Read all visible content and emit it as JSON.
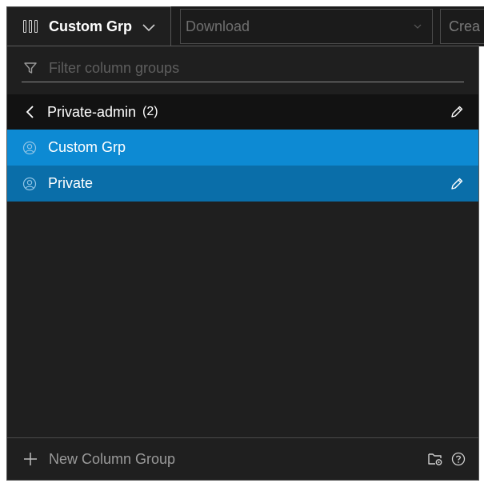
{
  "toolbar": {
    "column_group_button": {
      "label": "Custom Grp",
      "icon": "columns-icon",
      "chevron_icon": "chevron-down-icon"
    },
    "download": {
      "label": "Download",
      "chevron_icon": "chevron-down-icon"
    },
    "create": {
      "label": "Crea"
    }
  },
  "dropdown": {
    "filter": {
      "placeholder": "Filter column groups",
      "value": "",
      "icon": "filter-icon"
    },
    "group_header": {
      "label": "Private-admin",
      "count": "(2)",
      "back_icon": "chevron-left-icon",
      "edit_icon": "pencil-icon"
    },
    "items": [
      {
        "label": "Custom Grp",
        "icon": "user-icon",
        "state": "selected"
      },
      {
        "label": "Private",
        "icon": "user-icon",
        "state": "hover",
        "edit_icon": "pencil-icon"
      }
    ],
    "footer": {
      "new_label": "New Column Group",
      "plus_icon": "plus-icon",
      "folder_icon": "folder-settings-icon",
      "help_icon": "help-icon"
    }
  },
  "colors": {
    "panel_bg": "#1f1f1f",
    "selected_bg": "#0d8ad3",
    "hover_bg": "#0a6ea9",
    "header_bg": "#121212"
  }
}
